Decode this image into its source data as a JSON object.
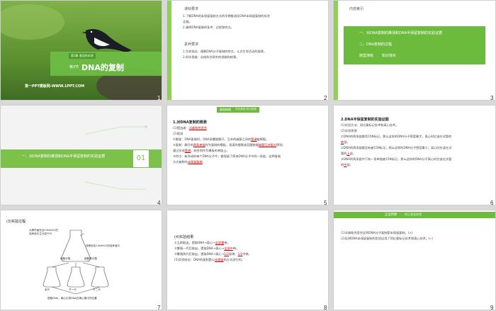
{
  "slides": [
    {
      "num": "1",
      "badge": "第3章 基因的本质",
      "section": "第3节",
      "title": "DNA的复制",
      "footer": "第一PPT模板网-WWW.1PPT.COM"
    },
    {
      "num": "2",
      "req1_title": "课标要求",
      "req1_lines": [
        "1.了解DNA的半保留复制方式的早期推测及DNA半保留复制的实验",
        "证据。",
        "2.阐明DNA复制的条件、过程和特点。"
      ],
      "req2_title": "素养要求",
      "req2_lines": [
        "1.生命观念：理解DNA分子复制的特点，认识生命活动的规律。",
        "2.科学思维：总结科学研究的思路和结果。"
      ]
    },
    {
      "num": "3",
      "title": "内容索引",
      "items": [
        "一、对DNA复制的推测和DNA半保留复制的实验证据",
        "二、DNA复制的过程"
      ],
      "links": [
        "随堂演练",
        "知识落实"
      ]
    },
    {
      "num": "4",
      "section_title": "一、对DNA复制的推测和DNA半保留复制的实验证据",
      "section_no": "01"
    },
    {
      "num": "5",
      "banner": "基础梳理",
      "banner2": "夯实基础 知识梳理",
      "heading": "1.对DNA复制的推测",
      "lines": [
        "(1)提出者：",
        "(2)假说",
        "①解旋：DNA复制时，DNA双螺旋解开，互补的碱基之间的",
        "被断裂。",
        "②复制：解开的",
        "作为复制的模板，游离的脱氧核苷酸依据",
        "原则，",
        "通过形成",
        "，结合到作为模板的单链上。",
        "③特点：新合成的每个DNA分子中，都保留了原来DNA分子中的一条链，这种复制",
        "方式被称作"
      ],
      "fills": [
        "沃森和克里克",
        "氢键",
        "两条单链",
        "碱基互补配对",
        "氢键",
        "半保留复制"
      ]
    },
    {
      "num": "6",
      "heading": "2.DNA半保留复制的实验证据",
      "lines": [
        "(1)实验方法：同位素标记技术和离心技术。",
        "(2)实验原理",
        "①DNA的两条链都用15N标记，那么这样的DNA分子密度最大，离心时应该在试管的",
        "部。",
        "②DNA的两条链都没有被15N标记，那么这样的DNA分子密度最小，离心时应该在试",
        "管的",
        "部。",
        "③DNA的两条链中只有一条单链被15N标记，那么这样的DNA分子离心时应该在试管",
        "的",
        "部。"
      ],
      "fills": [
        "底",
        "上",
        "中"
      ]
    },
    {
      "num": "7",
      "title": "(3)实验过程",
      "labels": [
        "大肠杆菌在含15NH4Cl的",
        "培养液中生长若干代",
        "转移到含14NH4Cl的培养液中",
        "提取DNA,离心",
        "细胞分裂",
        "一次",
        "细胞再分裂",
        "一次",
        "15N/15N-DNA",
        "15N/14N-DNA",
        "14N/14N-DNA",
        "15N/14N-DNA",
        "提取DNA，离心记录DNA在离心管中的位置",
        "亲代",
        "子一代",
        "子二代"
      ]
    },
    {
      "num": "8",
      "heading": "(4)实验结果",
      "lines": [
        "①立即取出，提取DNA→离心→",
        "带。",
        "②繁殖一代后取出，提取DNA→离心→",
        "带。",
        "③繁殖两代后取出，提取DNA→离心→",
        "轻带、",
        "中带。",
        "(5)实验结论：DNA的复制是以",
        "的方式进行的。"
      ],
      "fills": [
        "全部重",
        "全部中",
        "1/2",
        "1/2",
        "半保留"
      ]
    },
    {
      "num": "9",
      "banner": "正误判断",
      "banner2": "矫正易混易错",
      "lines": [
        "(1)沃森和克里克证明DNA分子复制是半保留复制。(",
        "×",
        ")",
        "(2)证明DNA半保留复制的实验运用了同位素标记技术和离心技术。(",
        "√",
        ")"
      ]
    }
  ],
  "colors": {
    "accent": "#6dbb3c",
    "green_dark": "#5aa02c",
    "red": "#c00000"
  }
}
